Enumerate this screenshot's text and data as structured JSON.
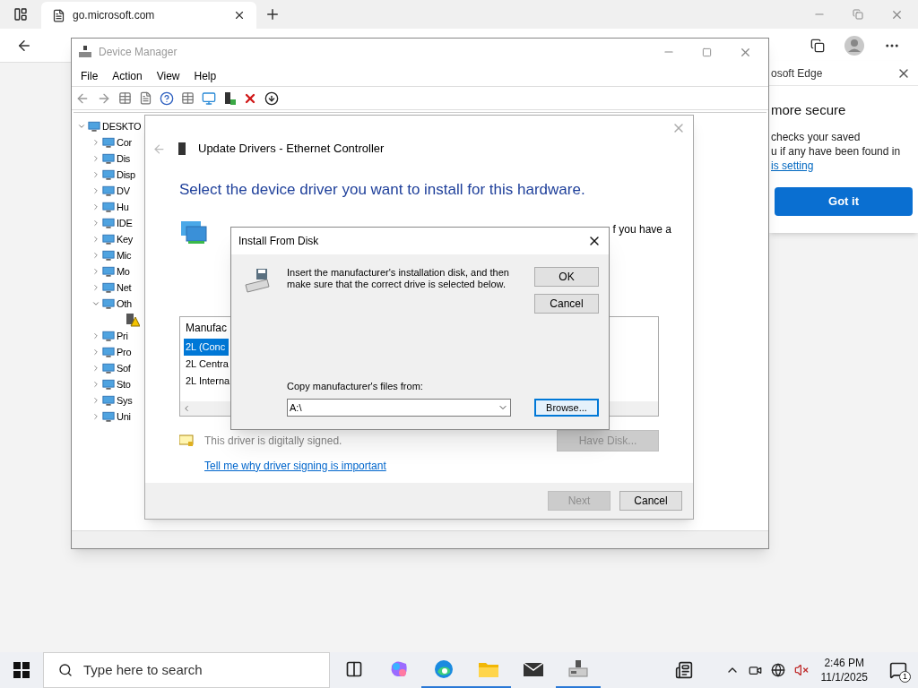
{
  "browser": {
    "tab_title": "go.microsoft.com"
  },
  "device_manager": {
    "title": "Device Manager",
    "menu": [
      "File",
      "Action",
      "View",
      "Help"
    ],
    "tree": {
      "label": "DESKTO",
      "expanded": true,
      "children": [
        {
          "label": "Cor",
          "expanded": false
        },
        {
          "label": "Dis",
          "expanded": false
        },
        {
          "label": "Disp",
          "expanded": false
        },
        {
          "label": "DV",
          "expanded": false
        },
        {
          "label": "Hu",
          "expanded": false
        },
        {
          "label": "IDE",
          "expanded": false
        },
        {
          "label": "Key",
          "expanded": false
        },
        {
          "label": "Mic",
          "expanded": false
        },
        {
          "label": "Mo",
          "expanded": false
        },
        {
          "label": "Net",
          "expanded": false
        },
        {
          "label": "Oth",
          "expanded": true,
          "children": [
            {
              "warning": true
            }
          ]
        },
        {
          "label": "Pri",
          "expanded": false
        },
        {
          "label": "Pro",
          "expanded": false
        },
        {
          "label": "Sof",
          "expanded": false
        },
        {
          "label": "Sto",
          "expanded": false
        },
        {
          "label": "Sys",
          "expanded": false
        },
        {
          "label": "Uni",
          "expanded": false
        }
      ]
    }
  },
  "edge_popup": {
    "title_fragment": "osoft Edge",
    "heading": "more secure",
    "lines": [
      "checks your saved",
      "u if any have been found in"
    ],
    "link": "is setting",
    "button": "Got it"
  },
  "update_drivers": {
    "title": "Update Drivers - Ethernet Controller",
    "heading": "Select the device driver you want to install for this hardware.",
    "intro_fragment": "f you have a",
    "list": {
      "header": "Manufac",
      "items": [
        {
          "label": "2L (Conc",
          "selected": true
        },
        {
          "label": "2L Centra",
          "selected": false
        },
        {
          "label": "2L Interna",
          "selected": false
        }
      ]
    },
    "signed_note": "This driver is digitally signed.",
    "signing_link": "Tell me why driver signing is important",
    "have_disk": {
      "label": "Have Disk...",
      "disabled": true
    },
    "buttons": [
      {
        "label": "Next",
        "disabled": true
      },
      {
        "label": "Cancel",
        "disabled": false
      }
    ]
  },
  "install_dialog": {
    "title": "Install From Disk",
    "message": "Insert the manufacturer's installation disk, and then make sure that the correct drive is selected below.",
    "buttons": [
      "OK",
      "Cancel"
    ],
    "copy_label": "Copy manufacturer's files from:",
    "path": "A:\\",
    "browse": "Browse..."
  },
  "taskbar": {
    "search_placeholder": "Type here to search",
    "apps": [
      {
        "kind": "task-view",
        "active": false
      },
      {
        "kind": "copilot",
        "active": false
      },
      {
        "kind": "edge",
        "active": true
      },
      {
        "kind": "folder",
        "active": true
      },
      {
        "kind": "mail",
        "active": false
      },
      {
        "kind": "device-manager",
        "active": true
      }
    ],
    "time": "2:46 PM",
    "date": "11/1/2025",
    "notifications": "1"
  }
}
